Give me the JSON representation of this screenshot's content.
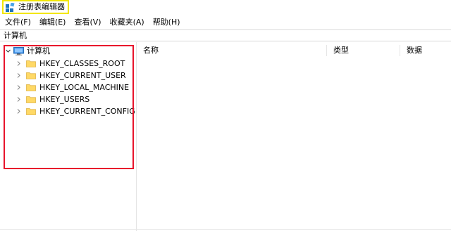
{
  "window": {
    "title": "注册表编辑器"
  },
  "menu": [
    "文件(F)",
    "编辑(E)",
    "查看(V)",
    "收藏夹(A)",
    "帮助(H)"
  ],
  "address": "计算机",
  "tree": {
    "root": "计算机",
    "children": [
      "HKEY_CLASSES_ROOT",
      "HKEY_CURRENT_USER",
      "HKEY_LOCAL_MACHINE",
      "HKEY_USERS",
      "HKEY_CURRENT_CONFIG"
    ]
  },
  "list_columns": [
    "名称",
    "类型",
    "数据"
  ],
  "colors": {
    "highlight_title": "#f2e600",
    "highlight_tree": "#e8142c",
    "folder": "#ffd966"
  }
}
